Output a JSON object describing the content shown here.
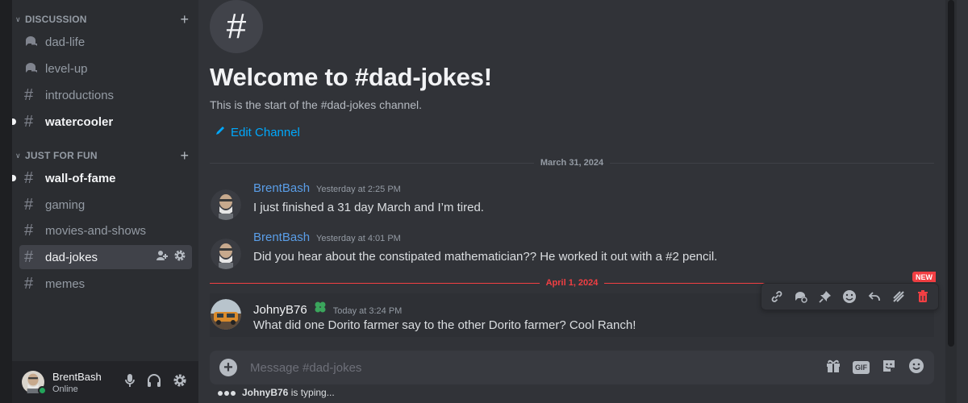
{
  "colors": {
    "background": "#313338",
    "sidebar": "#2b2d31",
    "link": "#00a8fc",
    "author": "#5a9ee8",
    "new_divider": "#f23f43",
    "online": "#23a55a"
  },
  "sidebar": {
    "categories": [
      {
        "label": "DISCUSSION",
        "channels": [
          {
            "name": "dad-life",
            "type": "forum",
            "unread": false
          },
          {
            "name": "level-up",
            "type": "forum",
            "unread": false
          },
          {
            "name": "introductions",
            "type": "text",
            "unread": false
          },
          {
            "name": "watercooler",
            "type": "text",
            "unread": true
          }
        ]
      },
      {
        "label": "JUST FOR FUN",
        "channels": [
          {
            "name": "wall-of-fame",
            "type": "text",
            "unread": true
          },
          {
            "name": "gaming",
            "type": "text",
            "unread": false
          },
          {
            "name": "movies-and-shows",
            "type": "text",
            "unread": false
          },
          {
            "name": "dad-jokes",
            "type": "text",
            "selected": true
          },
          {
            "name": "memes",
            "type": "text",
            "unread": false
          }
        ]
      }
    ]
  },
  "user_panel": {
    "username": "BrentBash",
    "status": "Online"
  },
  "channel": {
    "welcome_title": "Welcome to #dad-jokes!",
    "welcome_subtitle": "This is the start of the #dad-jokes channel.",
    "edit_label": "Edit Channel"
  },
  "dividers": {
    "first": "March 31, 2024",
    "second": "April 1, 2024",
    "new_badge": "NEW"
  },
  "messages": [
    {
      "author": "BrentBash",
      "time": "Yesterday at 2:25 PM",
      "content": "I just finished a 31 day March and I’m tired."
    },
    {
      "author": "BrentBash",
      "time": "Yesterday at 4:01 PM",
      "content": "Did you hear about the constipated mathematician?? He worked it out with a #2 pencil."
    },
    {
      "author": "JohnyB76",
      "time": "Today at 3:24 PM",
      "content": "What did one Dorito farmer say to the other Dorito farmer? Cool Ranch!"
    }
  ],
  "composer": {
    "placeholder": "Message #dad-jokes",
    "gif_label": "GIF"
  },
  "typing": {
    "user": "JohnyB76",
    "text": "is typing..."
  }
}
